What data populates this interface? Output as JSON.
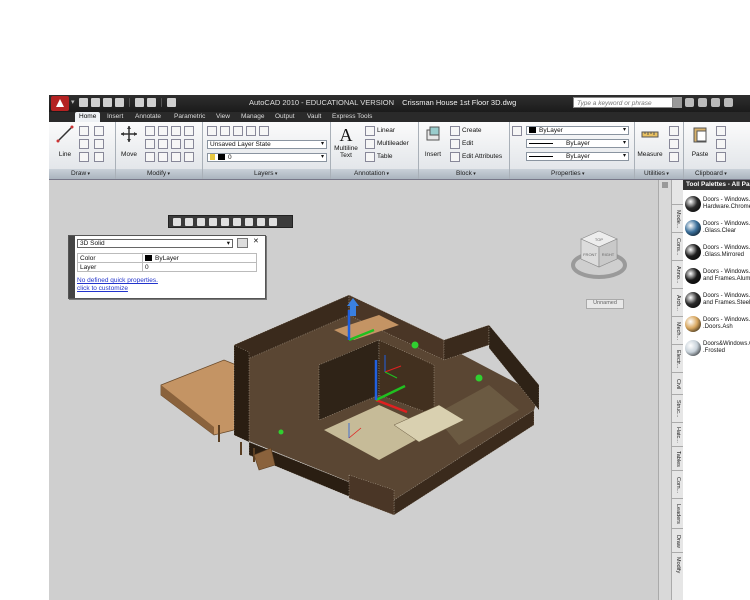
{
  "app": {
    "title": "AutoCAD 2010 - EDUCATIONAL VERSION",
    "drawing_name": "Crissman House 1st Floor 3D.dwg",
    "search_placeholder": "Type a keyword or phrase"
  },
  "ribbon_tabs": [
    "Home",
    "Insert",
    "Annotate",
    "Parametric",
    "View",
    "Manage",
    "Output",
    "Vault",
    "Express Tools"
  ],
  "panels": {
    "draw": "Draw",
    "modify": "Modify",
    "layers": "Layers",
    "annotation": "Annotation",
    "block": "Block",
    "properties": "Properties",
    "utilities": "Utilities",
    "clipboard": "Clipboard"
  },
  "buttons": {
    "line": "Line",
    "move": "Move",
    "multiline_text": "Multiline Text",
    "linear": "Linear",
    "multileader": "Multileader",
    "table": "Table",
    "insert": "Insert",
    "create": "Create",
    "edit": "Edit",
    "edit_attributes": "Edit Attributes",
    "measure": "Measure",
    "paste": "Paste"
  },
  "layers": {
    "layer_state": "Unsaved Layer State",
    "current_layer": "0"
  },
  "properties_panel": {
    "color": "ByLayer",
    "linetype": "ByLayer",
    "lineweight": "ByLayer"
  },
  "quick_properties": {
    "object_type": "3D Solid",
    "rows": [
      {
        "label": "Color",
        "value": "ByLayer"
      },
      {
        "label": "Layer",
        "value": "0"
      }
    ],
    "link_line1": "No defined quick properties.",
    "link_line2": "click to customize"
  },
  "viewcube": {
    "top": "TOP",
    "front": "FRONT",
    "right": "RIGHT",
    "view_label": "Unnamed"
  },
  "tool_palettes": {
    "title": "Tool Palettes - All Pa",
    "items": [
      {
        "line1": "Doors - Windows...",
        "line2": "Hardware.Chrome",
        "color": "#2a2a2a"
      },
      {
        "line1": "Doors - Windows...",
        "line2": ".Glass.Clear",
        "color": "#3a6f9a"
      },
      {
        "line1": "Doors - Windows...",
        "line2": ".Glass.Mirrored",
        "color": "#1e1e1e"
      },
      {
        "line1": "Doors - Windows...",
        "line2": "and Frames.Alumi",
        "color": "#1a1a1a"
      },
      {
        "line1": "Doors - Windows...",
        "line2": "and Frames.Steel",
        "color": "#2c2c2c"
      },
      {
        "line1": "Doors - Windows...",
        "line2": ".Doors.Ash",
        "color": "#d9a860"
      },
      {
        "line1": "Doors&Windows.G...",
        "line2": ".Frosted",
        "color": "#c8d2da"
      }
    ],
    "side_tabs": [
      "Mode...",
      "Cons...",
      "Anno...",
      "Arch...",
      "Mech...",
      "Electr...",
      "Civil",
      "Struc...",
      "Hatc...",
      "Tables",
      "Com...",
      "Leaders",
      "Draw",
      "Modify"
    ]
  },
  "colors": {
    "title_bar": "#1f1f1f",
    "autocad_red": "#b42222",
    "viewport_bg": "#cfcfcf",
    "wall_dark": "#3a2a1c",
    "floor": "#c49464",
    "ucs_x": "#e02020",
    "ucs_y": "#20c020",
    "ucs_z": "#2060e0"
  }
}
